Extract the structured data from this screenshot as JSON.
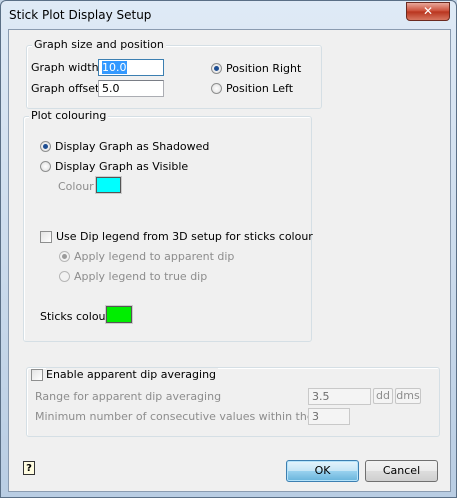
{
  "window": {
    "title": "Stick Plot Display Setup",
    "close_glyph": "✕"
  },
  "graph_group": {
    "title": "Graph size and position",
    "width_label": "Graph width",
    "width_value": "10.0",
    "offset_label": "Graph offset",
    "offset_value": "5.0",
    "position_right": "Position Right",
    "position_left": "Position Left",
    "selected_position": "right"
  },
  "plot_group": {
    "title": "Plot colouring",
    "shadowed_label": "Display Graph as Shadowed",
    "visible_label": "Display Graph as Visible",
    "selected_mode": "shadowed",
    "colour_label": "Colour",
    "colour_value": "#00ffff",
    "dip_legend_label": "Use Dip legend from 3D setup for sticks colour",
    "dip_legend_checked": false,
    "apparent_dip_label": "Apply legend to apparent dip",
    "true_dip_label": "Apply legend to true dip",
    "sticks_colour_label": "Sticks colour",
    "sticks_colour_value": "#00ee00"
  },
  "averaging_group": {
    "enable_label": "Enable apparent dip averaging",
    "enabled": false,
    "range_label": "Range for apparent dip averaging",
    "range_value": "3.5",
    "unit_dd": "dd",
    "unit_dms": "dms",
    "min_label": "Minimum number of consecutive values within the range",
    "min_value": "3"
  },
  "buttons": {
    "help": "?",
    "ok": "OK",
    "cancel": "Cancel"
  }
}
